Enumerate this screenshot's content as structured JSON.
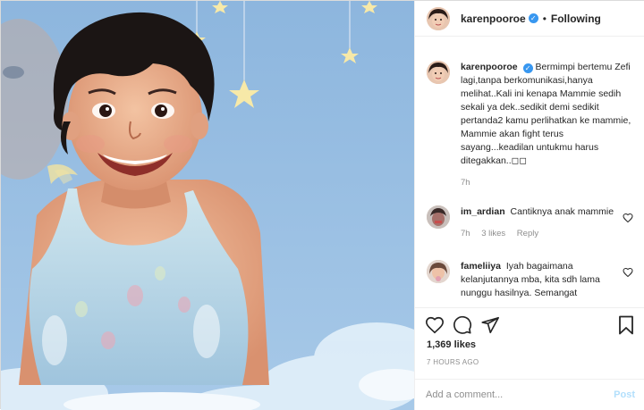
{
  "post": {
    "username": "karenpooroe",
    "following_label": "Following",
    "separator": "•",
    "verified_mark": "✓",
    "image_description_icon": "cartoon-girl-illustration"
  },
  "caption": {
    "username": "karenpooroe",
    "text": "Bermimpi bertemu Zefi lagi,tanpa berkomunikasi,hanya melihat..Kali ini kenapa Mammie sedih sekali ya dek..sedikit demi sedikit pertanda2 kamu perlihatkan ke mammie, Mammie akan fight terus sayang...keadilan untukmu harus ditegakkan..◻◻",
    "time": "7h"
  },
  "comments": [
    {
      "username": "im_ardian",
      "text": "Cantiknya anak mammie",
      "time": "7h",
      "likes": "3 likes",
      "reply": "Reply"
    },
    {
      "username": "fameliiya",
      "text": "Iyah bagaimana kelanjutannya mba, kita sdh lama nunggu hasilnya. Semangat"
    }
  ],
  "actions": {
    "likes": "1,369 likes",
    "timestamp": "7 HOURS AGO"
  },
  "composer": {
    "placeholder": "Add a comment...",
    "post_label": "Post"
  },
  "colors": {
    "accent": "#3897f0",
    "post_disabled": "#b2dffc",
    "sky": "#9cc3e6"
  }
}
